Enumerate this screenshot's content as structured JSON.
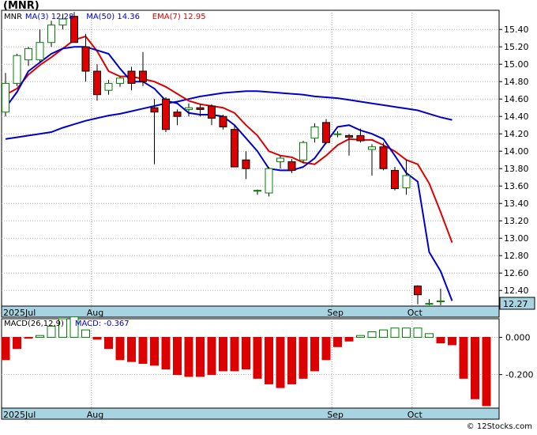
{
  "symbol_title": "(MNR)",
  "credit": "© 12Stocks.com",
  "colors": {
    "ma_short": "#0000cc",
    "ma_long": "#0000cc",
    "ema": "#dd0000",
    "candle_up": "#008000",
    "candle_down": "#dd0000",
    "macd_pos": "#008000",
    "macd_neg": "#dd0000",
    "axis_band": "#a8d4e2",
    "price_badge": "#a8d4e2"
  },
  "chart_data": [
    {
      "type": "candlestick",
      "name": "price",
      "legend": [
        {
          "label": "MNR",
          "color": "#000000"
        },
        {
          "label": "MA(3)",
          "value": "12.28",
          "color": "#0000cc"
        },
        {
          "label": "MA(50)",
          "value": "14.36",
          "color": "#0000cc"
        },
        {
          "label": "EMA(7)",
          "value": "12.95",
          "color": "#dd0000"
        }
      ],
      "ylim": [
        12.22,
        15.62
      ],
      "yticks": [
        "15.40",
        "15.20",
        "15.00",
        "14.80",
        "14.60",
        "14.40",
        "14.20",
        "14.00",
        "13.80",
        "13.60",
        "13.40",
        "13.20",
        "13.00",
        "12.80",
        "12.60",
        "12.40"
      ],
      "last_price": "12.27",
      "month_labels": [
        {
          "label": "2025Jul",
          "index": 0
        },
        {
          "label": "Aug",
          "index": 8
        },
        {
          "label": "Sep",
          "index": 29
        },
        {
          "label": "Oct",
          "index": 36
        }
      ],
      "candles": [
        {
          "o": 14.45,
          "h": 14.9,
          "l": 14.4,
          "c": 14.78
        },
        {
          "o": 14.78,
          "h": 15.12,
          "l": 14.75,
          "c": 15.1
        },
        {
          "o": 15.05,
          "h": 15.2,
          "l": 14.98,
          "c": 15.18
        },
        {
          "o": 15.05,
          "h": 15.4,
          "l": 15.02,
          "c": 15.25
        },
        {
          "o": 15.25,
          "h": 15.5,
          "l": 15.2,
          "c": 15.45
        },
        {
          "o": 15.45,
          "h": 15.58,
          "l": 15.4,
          "c": 15.52
        },
        {
          "o": 15.55,
          "h": 15.6,
          "l": 15.45,
          "c": 15.25
        },
        {
          "o": 15.2,
          "h": 15.35,
          "l": 14.8,
          "c": 14.92
        },
        {
          "o": 14.92,
          "h": 15.0,
          "l": 14.58,
          "c": 14.65
        },
        {
          "o": 14.7,
          "h": 14.82,
          "l": 14.65,
          "c": 14.78
        },
        {
          "o": 14.78,
          "h": 14.86,
          "l": 14.74,
          "c": 14.84
        },
        {
          "o": 14.92,
          "h": 14.97,
          "l": 14.7,
          "c": 14.78
        },
        {
          "o": 14.92,
          "h": 15.14,
          "l": 14.75,
          "c": 14.8
        },
        {
          "o": 14.5,
          "h": 14.6,
          "l": 13.85,
          "c": 14.45
        },
        {
          "o": 14.6,
          "h": 14.62,
          "l": 14.22,
          "c": 14.25
        },
        {
          "o": 14.45,
          "h": 14.48,
          "l": 14.3,
          "c": 14.4
        },
        {
          "o": 14.48,
          "h": 14.55,
          "l": 14.4,
          "c": 14.5
        },
        {
          "o": 14.5,
          "h": 14.54,
          "l": 14.4,
          "c": 14.48
        },
        {
          "o": 14.52,
          "h": 14.54,
          "l": 14.3,
          "c": 14.38
        },
        {
          "o": 14.4,
          "h": 14.42,
          "l": 14.25,
          "c": 14.28
        },
        {
          "o": 14.25,
          "h": 14.3,
          "l": 13.82,
          "c": 13.82
        },
        {
          "o": 13.9,
          "h": 14.0,
          "l": 13.68,
          "c": 13.8
        },
        {
          "o": 13.55,
          "h": 13.56,
          "l": 13.5,
          "c": 13.55
        },
        {
          "o": 13.52,
          "h": 13.82,
          "l": 13.48,
          "c": 13.8
        },
        {
          "o": 13.88,
          "h": 13.95,
          "l": 13.8,
          "c": 13.92
        },
        {
          "o": 13.88,
          "h": 13.91,
          "l": 13.75,
          "c": 13.78
        },
        {
          "o": 13.9,
          "h": 14.12,
          "l": 13.86,
          "c": 14.1
        },
        {
          "o": 14.15,
          "h": 14.32,
          "l": 14.1,
          "c": 14.28
        },
        {
          "o": 14.33,
          "h": 14.37,
          "l": 14.08,
          "c": 14.1
        },
        {
          "o": 14.2,
          "h": 14.23,
          "l": 14.16,
          "c": 14.2
        },
        {
          "o": 14.18,
          "h": 14.2,
          "l": 13.95,
          "c": 14.16
        },
        {
          "o": 14.18,
          "h": 14.26,
          "l": 14.1,
          "c": 14.12
        },
        {
          "o": 14.02,
          "h": 14.08,
          "l": 13.72,
          "c": 14.05
        },
        {
          "o": 14.05,
          "h": 14.1,
          "l": 13.78,
          "c": 13.8
        },
        {
          "o": 13.78,
          "h": 13.82,
          "l": 13.55,
          "c": 13.57
        },
        {
          "o": 13.58,
          "h": 13.9,
          "l": 13.5,
          "c": 13.72
        },
        {
          "o": 12.45,
          "h": 12.46,
          "l": 12.24,
          "c": 12.35
        },
        {
          "o": 12.25,
          "h": 12.3,
          "l": 12.23,
          "c": 12.25
        },
        {
          "o": 12.27,
          "h": 12.42,
          "l": 12.23,
          "c": 12.28
        }
      ],
      "ma3": [
        14.5,
        14.68,
        14.92,
        15.02,
        15.12,
        15.18,
        15.2,
        15.2,
        15.16,
        15.12,
        14.95,
        14.8,
        14.8,
        14.72,
        14.58,
        14.55,
        14.44,
        14.42,
        14.42,
        14.4,
        14.3,
        14.15,
        14.0,
        13.8,
        13.78,
        13.78,
        13.82,
        13.92,
        14.1,
        14.28,
        14.3,
        14.24,
        14.2,
        14.14,
        13.95,
        13.75,
        13.65,
        12.84,
        12.62,
        12.28
      ],
      "ma50": [
        14.14,
        14.16,
        14.18,
        14.2,
        14.22,
        14.27,
        14.31,
        14.35,
        14.38,
        14.41,
        14.43,
        14.46,
        14.49,
        14.52,
        14.55,
        14.57,
        14.6,
        14.63,
        14.65,
        14.67,
        14.68,
        14.69,
        14.69,
        14.68,
        14.67,
        14.66,
        14.65,
        14.63,
        14.62,
        14.61,
        14.59,
        14.57,
        14.55,
        14.53,
        14.51,
        14.49,
        14.47,
        14.43,
        14.39,
        14.36
      ],
      "ema7": [
        14.65,
        14.72,
        14.88,
        14.99,
        15.08,
        15.18,
        15.28,
        15.32,
        15.15,
        14.92,
        14.86,
        14.86,
        14.83,
        14.8,
        14.74,
        14.66,
        14.58,
        14.54,
        14.52,
        14.5,
        14.44,
        14.3,
        14.18,
        14.0,
        13.95,
        13.93,
        13.87,
        13.85,
        13.95,
        14.07,
        14.14,
        14.13,
        14.13,
        14.07,
        14.0,
        13.9,
        13.85,
        13.63,
        13.3,
        12.95
      ]
    },
    {
      "type": "bar",
      "name": "macd",
      "legend": [
        {
          "label": "MACD(26,12,9)",
          "color": "#000000"
        },
        {
          "label": "MACD:",
          "value": "-0.367",
          "color": "#0000cc"
        }
      ],
      "ylim": [
        -0.38,
        0.1
      ],
      "yticks": [
        "0.000",
        "-0.200"
      ],
      "values": [
        -0.12,
        -0.06,
        -0.005,
        0.01,
        0.06,
        0.1,
        0.11,
        0.04,
        -0.01,
        -0.06,
        -0.12,
        -0.13,
        -0.14,
        -0.15,
        -0.17,
        -0.2,
        -0.21,
        -0.21,
        -0.2,
        -0.18,
        -0.18,
        -0.17,
        -0.22,
        -0.25,
        -0.27,
        -0.25,
        -0.22,
        -0.18,
        -0.12,
        -0.05,
        -0.02,
        0.01,
        0.03,
        0.04,
        0.05,
        0.05,
        0.05,
        0.02,
        -0.03,
        -0.04,
        -0.22,
        -0.33,
        -0.367
      ]
    }
  ]
}
